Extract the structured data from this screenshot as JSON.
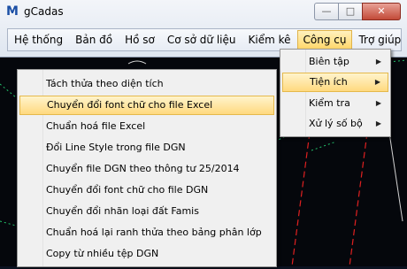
{
  "window": {
    "title": "gCadas",
    "app_icon_glyph": "M"
  },
  "menubar": {
    "items": [
      "Hệ thống",
      "Bản đồ",
      "Hồ sơ",
      "Cơ sở dữ liệu",
      "Kiểm kê",
      "Công cụ",
      "Trợ giúp"
    ],
    "active": "Công cụ"
  },
  "submenu": {
    "items": [
      "Biên tập",
      "Tiện ích",
      "Kiểm tra",
      "Xử lý số bộ"
    ],
    "highlighted": "Tiện ích"
  },
  "tools_menu": {
    "items": [
      "Tách thửa theo diện tích",
      "Chuyển đổi font chữ cho file Excel",
      "Chuẩn hoá file Excel",
      "Đổi Line Style trong file DGN",
      "Chuyển file DGN theo thông tư 25/2014",
      "Chuyển đổi font chữ cho file DGN",
      "Chuyển đổi nhãn loại đất Famis",
      "Chuẩn hoá lại ranh thửa theo bảng phân lớp",
      "Copy từ nhiều tệp DGN"
    ],
    "highlighted": "Chuyển đổi font chữ cho file Excel"
  },
  "colors": {
    "canvas": "#05070c",
    "cad_red": "#e02020",
    "cad_green": "#23c36b",
    "highlight": "#ffd97f"
  }
}
